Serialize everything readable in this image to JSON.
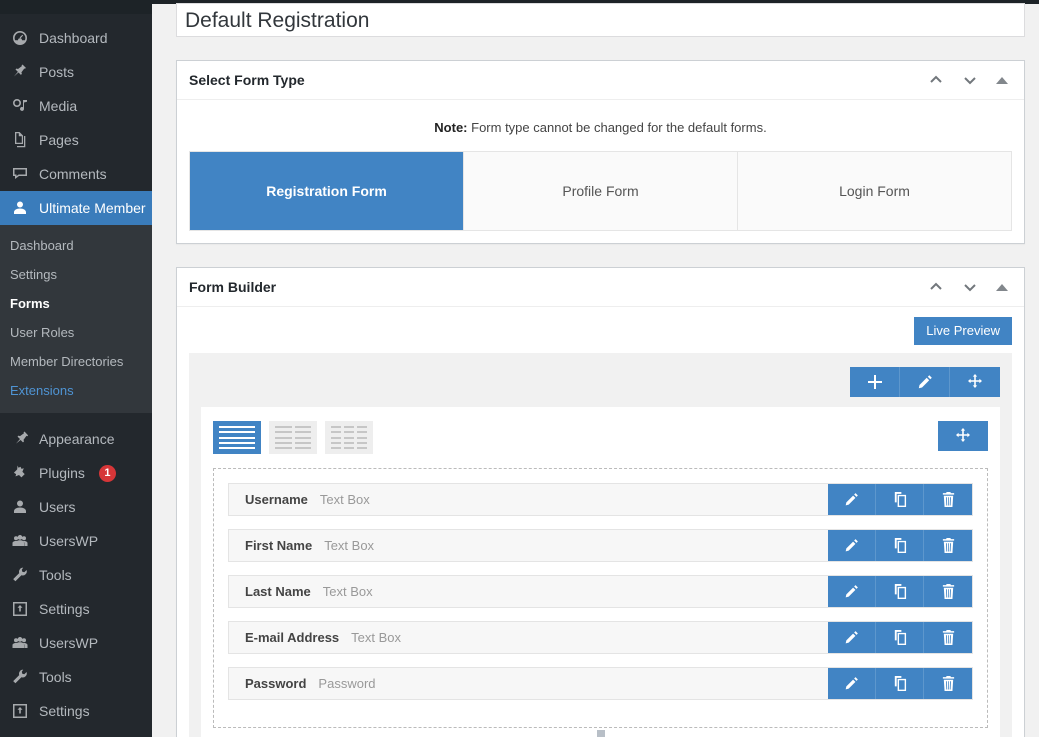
{
  "sidebar": {
    "menu": [
      {
        "label": "Dashboard",
        "icon": "dashboard-icon",
        "active": false
      },
      {
        "label": "Posts",
        "icon": "pin-icon",
        "active": false
      },
      {
        "label": "Media",
        "icon": "media-icon",
        "active": false
      },
      {
        "label": "Pages",
        "icon": "pages-icon",
        "active": false
      },
      {
        "label": "Comments",
        "icon": "comments-icon",
        "active": false
      },
      {
        "label": "Ultimate Member",
        "icon": "user-icon",
        "active": true
      }
    ],
    "submenu": [
      {
        "label": "Dashboard",
        "state": "normal"
      },
      {
        "label": "Settings",
        "state": "normal"
      },
      {
        "label": "Forms",
        "state": "current"
      },
      {
        "label": "User Roles",
        "state": "normal"
      },
      {
        "label": "Member Directories",
        "state": "normal"
      },
      {
        "label": "Extensions",
        "state": "link"
      }
    ],
    "menu_lower": [
      {
        "label": "Appearance",
        "icon": "appearance-icon",
        "badge": ""
      },
      {
        "label": "Plugins",
        "icon": "plugins-icon",
        "badge": "1"
      },
      {
        "label": "Users",
        "icon": "users-icon",
        "badge": ""
      },
      {
        "label": "UsersWP",
        "icon": "group-icon",
        "badge": ""
      },
      {
        "label": "Tools",
        "icon": "tools-icon",
        "badge": ""
      },
      {
        "label": "Settings",
        "icon": "settings-icon",
        "badge": ""
      },
      {
        "label": "UsersWP",
        "icon": "group-icon",
        "badge": ""
      },
      {
        "label": "Tools",
        "icon": "tools-icon",
        "badge": ""
      },
      {
        "label": "Settings",
        "icon": "settings-icon",
        "badge": ""
      }
    ]
  },
  "page": {
    "title": "Default Registration"
  },
  "form_type_panel": {
    "title": "Select Form Type",
    "note_prefix": "Note:",
    "note_text": " Form type cannot be changed for the default forms.",
    "tabs": [
      {
        "label": "Registration Form",
        "active": true
      },
      {
        "label": "Profile Form",
        "active": false
      },
      {
        "label": "Login Form",
        "active": false
      }
    ]
  },
  "form_builder": {
    "title": "Form Builder",
    "live_preview_label": "Live Preview",
    "row_toolbar": [
      {
        "icon": "plus-icon",
        "name": "add-row-button"
      },
      {
        "icon": "pencil-icon",
        "name": "edit-row-button"
      },
      {
        "icon": "move-icon",
        "name": "drag-row-button"
      }
    ],
    "column_layouts": [
      {
        "name": "one-column-layout",
        "columns": 1,
        "active": true
      },
      {
        "name": "two-column-layout",
        "columns": 2,
        "active": false
      },
      {
        "name": "three-column-layout",
        "columns": 3,
        "active": false
      }
    ],
    "fields": [
      {
        "label": "Username",
        "type": "Text Box"
      },
      {
        "label": "First Name",
        "type": "Text Box"
      },
      {
        "label": "Last Name",
        "type": "Text Box"
      },
      {
        "label": "E-mail Address",
        "type": "Text Box"
      },
      {
        "label": "Password",
        "type": "Password"
      }
    ],
    "field_actions": [
      {
        "icon": "pencil-icon",
        "name": "edit-field-button"
      },
      {
        "icon": "copy-icon",
        "name": "duplicate-field-button"
      },
      {
        "icon": "trash-icon",
        "name": "delete-field-button"
      }
    ]
  },
  "colors": {
    "accent_blue": "#4184c4",
    "sidebar_bg": "#23282d",
    "submenu_bg": "#32373c",
    "active_menu_blue": "#3a7cbb",
    "badge_red": "#d63638"
  }
}
